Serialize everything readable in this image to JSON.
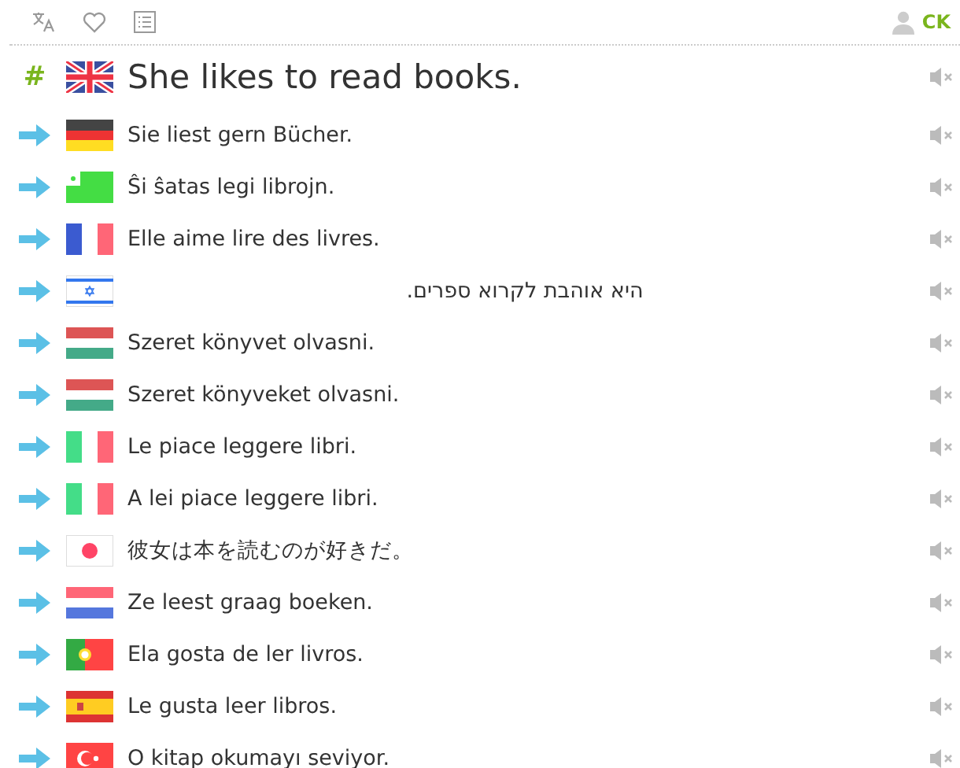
{
  "toolbar": {
    "user": "CK"
  },
  "main": {
    "mark": "#",
    "kind": "eng",
    "text": "She likes to read books."
  },
  "translations": [
    {
      "kind": "deu",
      "text": "Sie liest gern Bücher.",
      "rtl": false
    },
    {
      "kind": "epo",
      "text": "Ŝi ŝatas legi librojn.",
      "rtl": false
    },
    {
      "kind": "fra",
      "text": "Elle aime lire des livres.",
      "rtl": false
    },
    {
      "kind": "heb",
      "text": "היא אוהבת לקרוא ספרים.",
      "rtl": true
    },
    {
      "kind": "hun",
      "text": "Szeret könyvet olvasni.",
      "rtl": false
    },
    {
      "kind": "hun",
      "text": "Szeret könyveket olvasni.",
      "rtl": false
    },
    {
      "kind": "ita",
      "text": "Le piace leggere libri.",
      "rtl": false
    },
    {
      "kind": "ita",
      "text": "A lei piace leggere libri.",
      "rtl": false
    },
    {
      "kind": "jpn",
      "text": "彼女は本を読むのが好きだ。",
      "rtl": false
    },
    {
      "kind": "nld",
      "text": "Ze leest graag boeken.",
      "rtl": false
    },
    {
      "kind": "por",
      "text": "Ela gosta de ler livros.",
      "rtl": false
    },
    {
      "kind": "spa",
      "text": "Le gusta leer libros.",
      "rtl": false
    },
    {
      "kind": "tur",
      "text": "O kitap okumayı seviyor.",
      "rtl": false
    }
  ]
}
